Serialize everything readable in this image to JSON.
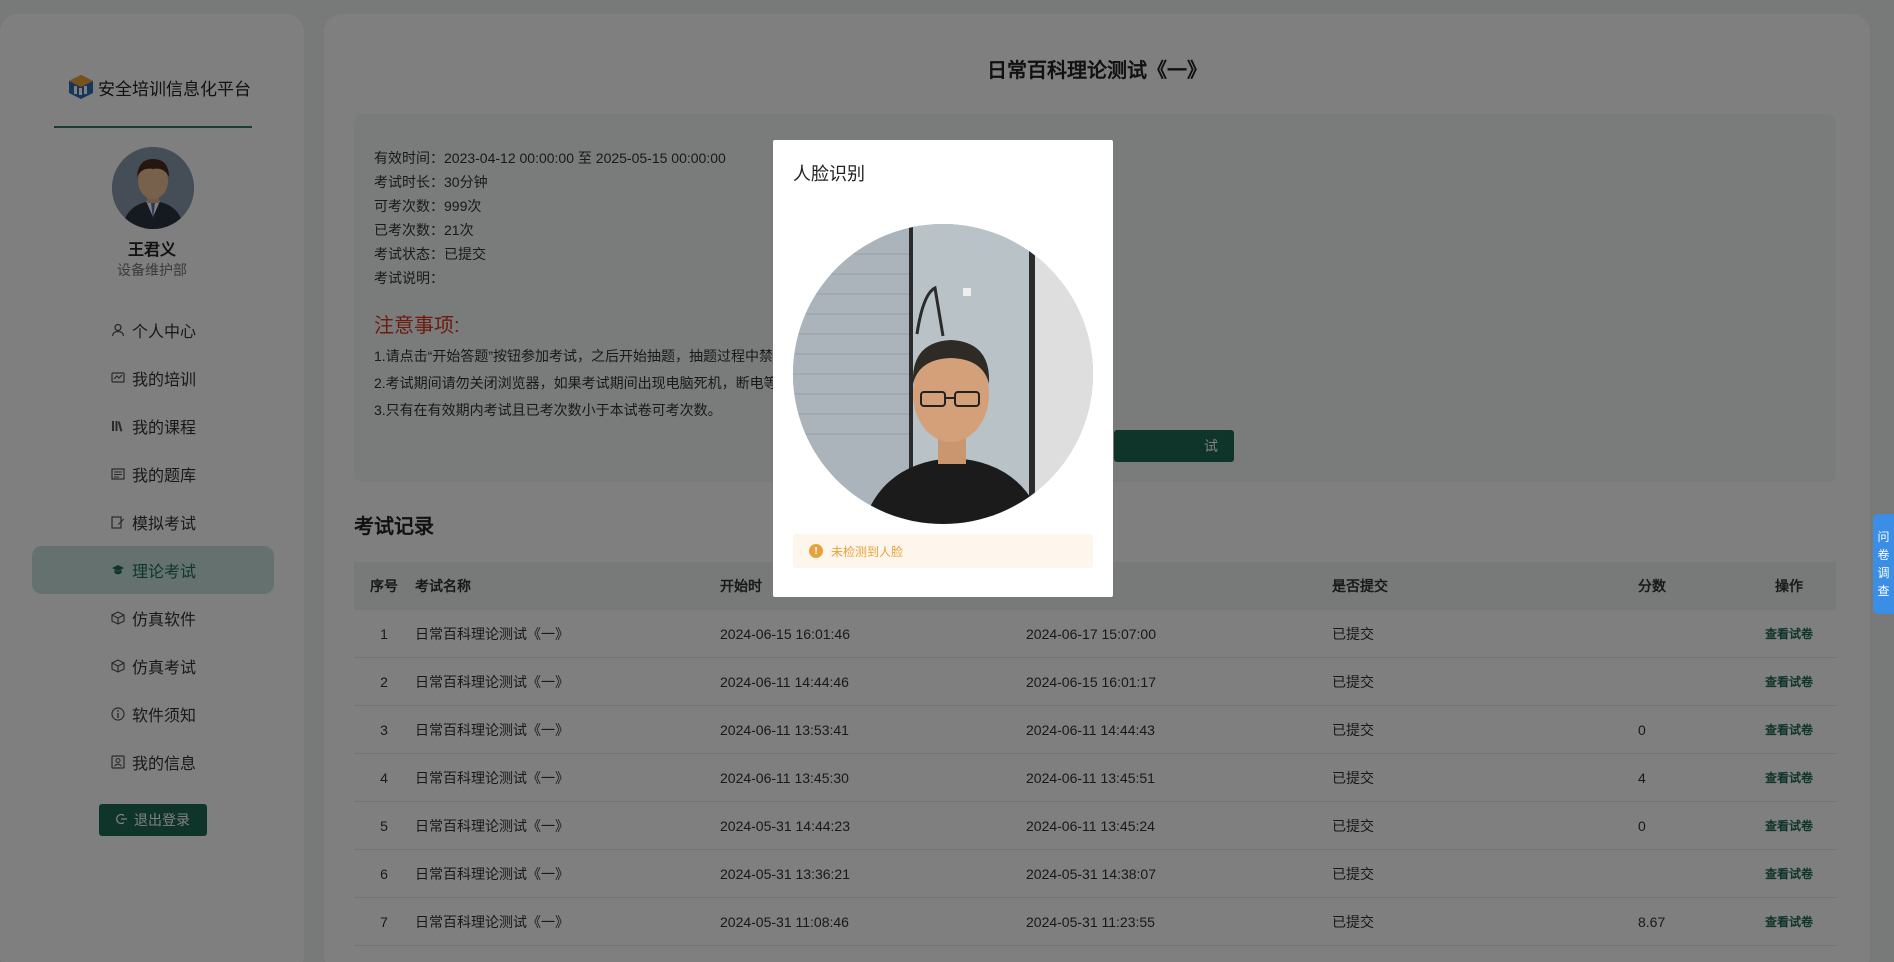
{
  "app": {
    "logo_text": "安全培训信息化平台"
  },
  "user": {
    "name": "王君义",
    "department": "设备维护部"
  },
  "sidebar": {
    "items": [
      {
        "label": "个人中心",
        "icon": "user-icon"
      },
      {
        "label": "我的培训",
        "icon": "training-icon"
      },
      {
        "label": "我的课程",
        "icon": "books-icon"
      },
      {
        "label": "我的题库",
        "icon": "question-bank-icon"
      },
      {
        "label": "模拟考试",
        "icon": "edit-icon"
      },
      {
        "label": "理论考试",
        "icon": "graduation-icon",
        "active": true
      },
      {
        "label": "仿真软件",
        "icon": "cube-icon"
      },
      {
        "label": "仿真考试",
        "icon": "cube-icon"
      },
      {
        "label": "软件须知",
        "icon": "info-icon"
      },
      {
        "label": "我的信息",
        "icon": "profile-icon"
      }
    ],
    "logout_label": "退出登录"
  },
  "exam": {
    "title": "日常百科理论测试《一》",
    "valid_time": "有效时间：2023-04-12 00:00:00 至 2025-05-15 00:00:00",
    "duration": "考试时长：30分钟",
    "allowed_attempts": "可考次数：999次",
    "used_attempts": "已考次数：21次",
    "status": "考试状态：已提交",
    "description": "考试说明："
  },
  "notice": {
    "title": "注意事项:",
    "line1": "1.请点击“开始答题”按钮参加考试，之后开始抽题，抽题过程中禁止刷新页面，抽题完成后，页面将会跳转到考试页面。",
    "line2": "2.考试期间请勿关闭浏览器，如果考试期间出现电脑死机，断电等情况，请重新登录后恢复考试。",
    "line3": "3.只有在有效期内考试且已考次数小于本试卷可考次数。",
    "start_button_partial": "试"
  },
  "records": {
    "title": "考试记录",
    "columns": [
      "序号",
      "考试名称",
      "开始时",
      "",
      "是否提交",
      "分数",
      "操作"
    ],
    "rows": [
      {
        "no": "1",
        "name": "日常百科理论测试《一》",
        "start": "2024-06-15 16:01:46",
        "end": "2024-06-17 15:07:00",
        "submitted": "已提交",
        "score": "",
        "action": "查看试卷"
      },
      {
        "no": "2",
        "name": "日常百科理论测试《一》",
        "start": "2024-06-11 14:44:46",
        "end": "2024-06-15 16:01:17",
        "submitted": "已提交",
        "score": "",
        "action": "查看试卷"
      },
      {
        "no": "3",
        "name": "日常百科理论测试《一》",
        "start": "2024-06-11 13:53:41",
        "end": "2024-06-11 14:44:43",
        "submitted": "已提交",
        "score": "0",
        "action": "查看试卷"
      },
      {
        "no": "4",
        "name": "日常百科理论测试《一》",
        "start": "2024-06-11 13:45:30",
        "end": "2024-06-11 13:45:51",
        "submitted": "已提交",
        "score": "4",
        "action": "查看试卷"
      },
      {
        "no": "5",
        "name": "日常百科理论测试《一》",
        "start": "2024-05-31 14:44:23",
        "end": "2024-06-11 13:45:24",
        "submitted": "已提交",
        "score": "0",
        "action": "查看试卷"
      },
      {
        "no": "6",
        "name": "日常百科理论测试《一》",
        "start": "2024-05-31 13:36:21",
        "end": "2024-05-31 14:38:07",
        "submitted": "已提交",
        "score": "",
        "action": "查看试卷"
      },
      {
        "no": "7",
        "name": "日常百科理论测试《一》",
        "start": "2024-05-31 11:08:46",
        "end": "2024-05-31 11:23:55",
        "submitted": "已提交",
        "score": "8.67",
        "action": "查看试卷"
      }
    ]
  },
  "face_dialog": {
    "title": "人脸识别",
    "alert": "未检测到人脸"
  },
  "survey_tab": {
    "chars": [
      "问",
      "卷",
      "调",
      "查"
    ]
  },
  "colors": {
    "primary": "#1f6b57",
    "notice": "#d9381e",
    "warning": "#e6a23c",
    "survey": "#3a8ee6"
  }
}
